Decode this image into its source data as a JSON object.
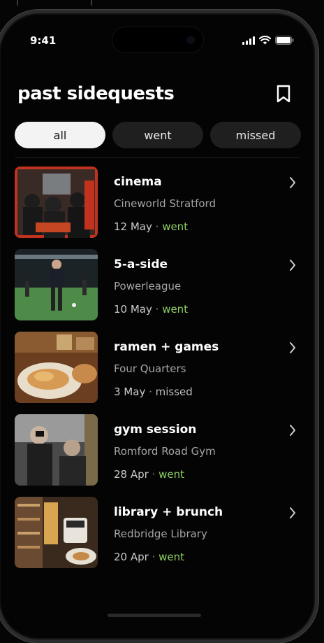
{
  "status_bar": {
    "time": "9:41"
  },
  "header": {
    "title": "past sidequests"
  },
  "filters": [
    {
      "label": "all",
      "active": true
    },
    {
      "label": "went",
      "active": false
    },
    {
      "label": "missed",
      "active": false
    }
  ],
  "items": [
    {
      "name": "cinema",
      "venue": "Cineworld Stratford",
      "date": "12 May",
      "sep": " · ",
      "status": "went",
      "thumb": "cinema-photo"
    },
    {
      "name": "5-a-side",
      "venue": "Powerleague",
      "date": "10 May",
      "sep": " · ",
      "status": "went",
      "thumb": "football-photo"
    },
    {
      "name": "ramen + games",
      "venue": "Four Quarters",
      "date": "3 May",
      "sep": " · ",
      "status": "missed",
      "thumb": "food-photo"
    },
    {
      "name": "gym session",
      "venue": "Romford Road Gym",
      "date": "28 Apr",
      "sep": " · ",
      "status": "went",
      "thumb": "gym-photo"
    },
    {
      "name": "library + brunch",
      "venue": "Redbridge Library",
      "date": "20 Apr",
      "sep": " · ",
      "status": "went",
      "thumb": "library-photo"
    }
  ],
  "colors": {
    "went": "#8ed063",
    "background": "#040404",
    "chip_active": "#f3f3f3"
  }
}
